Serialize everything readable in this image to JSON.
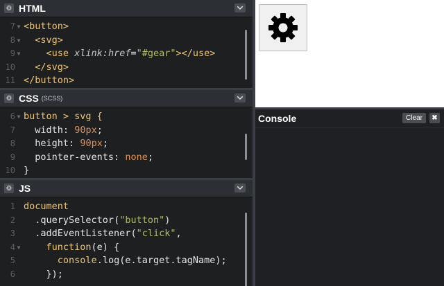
{
  "html_panel": {
    "title": "HTML",
    "lines": [
      {
        "n": "7",
        "fold": true
      },
      {
        "n": "8",
        "fold": true
      },
      {
        "n": "9",
        "fold": true
      },
      {
        "n": "10",
        "fold": false
      },
      {
        "n": "11",
        "fold": false
      }
    ],
    "code": {
      "l7_tag": "<button>",
      "l8_tag": "<svg>",
      "l9_open": "<use",
      "l9_attr": "xlink:href",
      "l9_eq": "=",
      "l9_val": "\"#gear\"",
      "l9_close": "></use>",
      "l10_tag": "</svg>",
      "l11_tag": "</button>"
    }
  },
  "css_panel": {
    "title": "CSS",
    "subtitle": "(SCSS)",
    "lines": [
      {
        "n": "6",
        "fold": true
      },
      {
        "n": "7",
        "fold": false
      },
      {
        "n": "8",
        "fold": false
      },
      {
        "n": "9",
        "fold": false
      },
      {
        "n": "10",
        "fold": false
      }
    ],
    "code": {
      "selector": "button > svg {",
      "width_prop": "width:",
      "width_val": "90px",
      "height_prop": "height:",
      "height_val": "90px",
      "pe_prop": "pointer-events:",
      "pe_val": "none",
      "close": "}"
    }
  },
  "js_panel": {
    "title": "JS",
    "lines": [
      {
        "n": "1",
        "fold": false
      },
      {
        "n": "2",
        "fold": false
      },
      {
        "n": "3",
        "fold": false
      },
      {
        "n": "4",
        "fold": true
      },
      {
        "n": "5",
        "fold": false
      },
      {
        "n": "6",
        "fold": false
      }
    ],
    "code": {
      "l1": "document",
      "l2_method": ".querySelector",
      "l2_arg": "\"button\"",
      "l3_method": ".addEventListener",
      "l3_arg": "\"click\"",
      "l4_kw": "function",
      "l4_rest": "(e) {",
      "l5_obj": "console",
      "l5_rest": ".log(e.target.tagName);",
      "l6": "});"
    }
  },
  "preview": {
    "button_icon": "gear-icon"
  },
  "console": {
    "title": "Console",
    "clear_label": "Clear",
    "close_label": "✖"
  },
  "icons": {
    "settings": "⚙",
    "collapse": "⌄"
  }
}
